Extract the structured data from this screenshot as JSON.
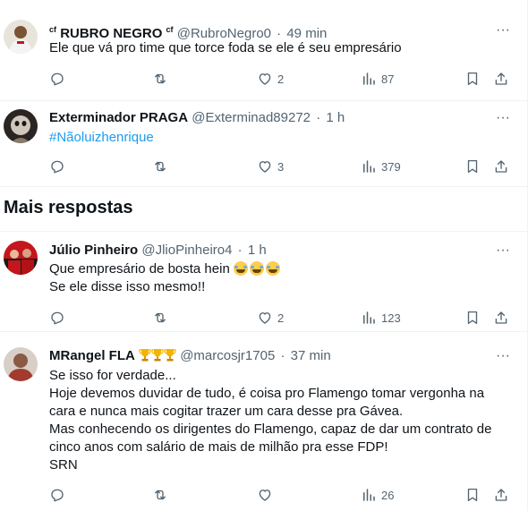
{
  "tweets": [
    {
      "pre_badge": "cf",
      "display_name": "RUBRO NEGRO",
      "post_badge": "cf",
      "handle": "@RubroNegro0",
      "time": "49 min",
      "text_lines": [
        "Ele que vá pro time que torce foda se ele é seu empresário"
      ],
      "replies": "",
      "retweets": "",
      "likes": "2",
      "views": "87"
    },
    {
      "display_name": "Exterminador PRAGA",
      "handle": "@Extermina d89272",
      "time": "1 h",
      "text_lines": [
        "#Nãoluizhenrique"
      ],
      "replies": "",
      "retweets": "",
      "likes": "3",
      "views": "379"
    },
    {
      "display_name": "Júlio Pinheiro",
      "handle": "@JlioPinheiro4",
      "time": "1 h",
      "text_lines": [
        "Que empresário de bosta hein",
        "Se ele disse isso mesmo!!"
      ],
      "replies": "",
      "retweets": "",
      "likes": "2",
      "views": "123"
    },
    {
      "display_name": "MRangel FLA",
      "handle": "@marcosjr1705",
      "time": "37 min",
      "text_lines": [
        "Se isso for verdade...",
        "Hoje devemos duvidar de tudo, é coisa pro Flamengo tomar vergonha na",
        "cara e nunca mais cogitar trazer um cara desse pra Gávea.",
        "Mas conhecendo os dirigentes do Flamengo, capaz de dar um contrato de",
        "cinco anos com salário de mais de milhão pra esse FDP!",
        "SRN"
      ],
      "replies": "",
      "retweets": "",
      "likes": "",
      "views": "26"
    }
  ],
  "section_title": "Mais respostas",
  "dot": "·",
  "more_label": "···",
  "colors": {
    "text": "#0f1419",
    "secondary": "#536471",
    "link": "#1d9bf0",
    "divider": "#eff3f4"
  },
  "icons": {
    "reply": "reply-icon",
    "retweet": "retweet-icon",
    "like": "heart-icon",
    "views": "views-icon",
    "bookmark": "bookmark-icon",
    "share": "share-icon",
    "more": "more-icon"
  }
}
